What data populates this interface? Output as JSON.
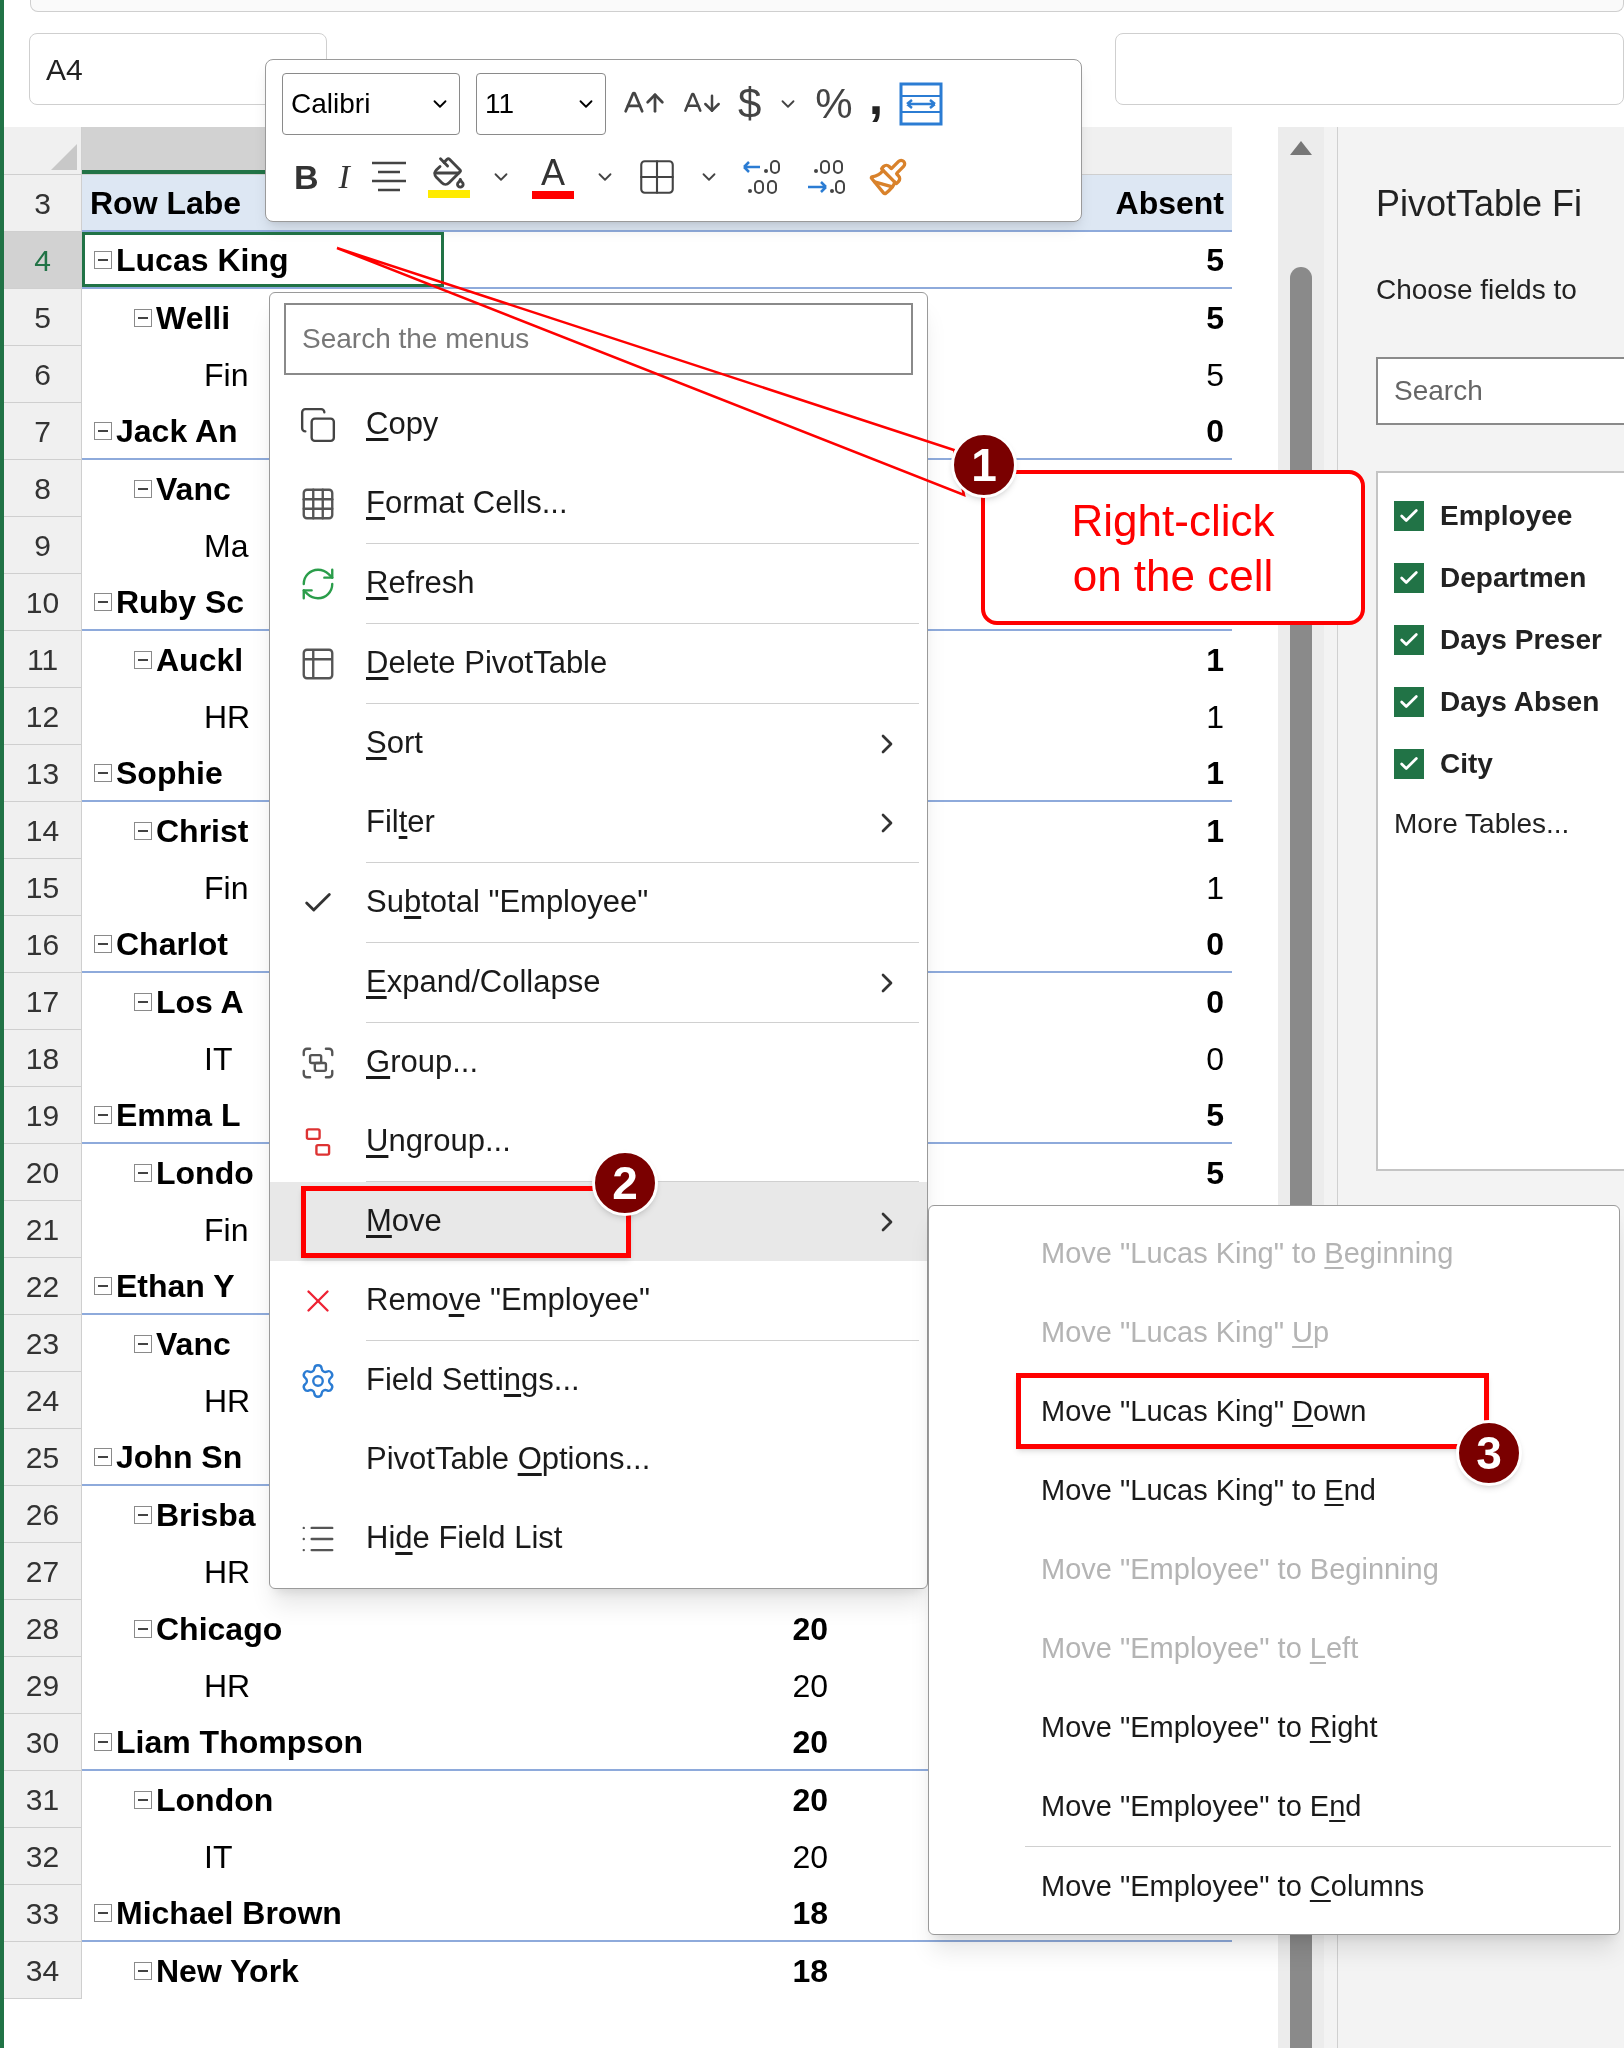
{
  "name_box": "A4",
  "mini_toolbar": {
    "font": "Calibri",
    "size": "11",
    "currency": "$",
    "percent": "%",
    "comma": ",",
    "bold": "B",
    "italic": "I",
    "font_color": "A"
  },
  "sheet": {
    "header_row": {
      "row": "3",
      "label": "Row Labe",
      "absent": "Absent"
    },
    "rows": [
      {
        "row": "4",
        "label": "Lucas King",
        "absent": "5",
        "expanded": true,
        "selected": true,
        "children": [
          {
            "row": "5",
            "label": "Welli",
            "absent": "5",
            "expanded": true,
            "selected": false,
            "children": [
              {
                "row": "6",
                "label": "Fin",
                "absent": "5",
                "selected": false
              }
            ]
          }
        ]
      },
      {
        "row": "7",
        "label": "Jack An",
        "absent": "0",
        "expanded": true,
        "selected": false,
        "children": [
          {
            "row": "8",
            "label": "Vanc",
            "expanded": true,
            "selected": false,
            "children": [
              {
                "row": "9",
                "label": "Ma",
                "selected": false
              }
            ]
          }
        ]
      },
      {
        "row": "10",
        "label": "Ruby Sc",
        "expanded": true,
        "selected": false,
        "children": [
          {
            "row": "11",
            "label": "Auckl",
            "absent": "1",
            "expanded": true,
            "selected": false,
            "children": [
              {
                "row": "12",
                "label": "HR",
                "absent": "1",
                "selected": false
              }
            ]
          }
        ]
      },
      {
        "row": "13",
        "label": "Sophie",
        "absent": "1",
        "expanded": true,
        "selected": false,
        "children": [
          {
            "row": "14",
            "label": "Christ",
            "absent": "1",
            "expanded": true,
            "selected": false,
            "children": [
              {
                "row": "15",
                "label": "Fin",
                "absent": "1",
                "selected": false
              }
            ]
          }
        ]
      },
      {
        "row": "16",
        "label": "Charlot",
        "absent": "0",
        "expanded": true,
        "selected": false,
        "children": [
          {
            "row": "17",
            "label": "Los A",
            "absent": "0",
            "expanded": true,
            "selected": false,
            "children": [
              {
                "row": "18",
                "label": "IT",
                "absent": "0",
                "selected": false
              }
            ]
          }
        ]
      },
      {
        "row": "19",
        "label": "Emma L",
        "absent": "5",
        "expanded": true,
        "selected": false,
        "children": [
          {
            "row": "20",
            "label": "Londo",
            "absent": "5",
            "expanded": true,
            "selected": false,
            "children": [
              {
                "row": "21",
                "label": "Fin",
                "selected": false
              }
            ]
          }
        ]
      },
      {
        "row": "22",
        "label": "Ethan Y",
        "expanded": true,
        "selected": false,
        "children": [
          {
            "row": "23",
            "label": "Vanc",
            "expanded": true,
            "selected": false,
            "children": [
              {
                "row": "24",
                "label": "HR",
                "selected": false
              }
            ]
          }
        ]
      },
      {
        "row": "25",
        "label": "John Sn",
        "expanded": true,
        "selected": false,
        "children": [
          {
            "row": "26",
            "label": "Brisba",
            "expanded": true,
            "selected": false,
            "children": [
              {
                "row": "27",
                "label": "HR",
                "selected": false
              }
            ]
          },
          {
            "row": "28",
            "label": "Chicago",
            "present": "20",
            "expanded": true,
            "selected": false,
            "children": [
              {
                "row": "29",
                "label": "HR",
                "present": "20",
                "selected": false
              }
            ]
          }
        ]
      },
      {
        "row": "30",
        "label": "Liam Thompson",
        "present": "20",
        "expanded": true,
        "selected": false,
        "children": [
          {
            "row": "31",
            "label": "London",
            "present": "20",
            "expanded": true,
            "selected": false,
            "children": [
              {
                "row": "32",
                "label": "IT",
                "present": "20",
                "selected": false
              }
            ]
          }
        ]
      },
      {
        "row": "33",
        "label": "Michael Brown",
        "present": "18",
        "expanded": true,
        "selected": false,
        "children": [
          {
            "row": "34",
            "label": "New York",
            "present": "18",
            "expanded": true,
            "selected": false
          }
        ]
      }
    ]
  },
  "context_menu": {
    "search_placeholder": "Search the menus",
    "items": [
      {
        "kind": "item",
        "key": "C",
        "after": "opy",
        "checked": false,
        "submenu": false,
        "selected": false
      },
      {
        "kind": "item",
        "key": "F",
        "after": "ormat Cells...",
        "checked": false,
        "submenu": false,
        "selected": false
      },
      {
        "kind": "separator"
      },
      {
        "kind": "item",
        "key": "R",
        "after": "efresh",
        "checked": false,
        "submenu": false,
        "selected": false
      },
      {
        "kind": "separator"
      },
      {
        "kind": "item",
        "key": "D",
        "after": "elete PivotTable",
        "checked": false,
        "submenu": false,
        "selected": false
      },
      {
        "kind": "separator"
      },
      {
        "kind": "item",
        "key": "S",
        "after": "ort",
        "checked": false,
        "submenu": true,
        "selected": false
      },
      {
        "kind": "item",
        "before": "Fil",
        "key": "t",
        "after": "er",
        "checked": false,
        "submenu": true,
        "selected": false
      },
      {
        "kind": "separator"
      },
      {
        "kind": "item",
        "before": "Su",
        "key": "b",
        "after": "total \"Employee\"",
        "checked": true,
        "submenu": false,
        "selected": false
      },
      {
        "kind": "separator"
      },
      {
        "kind": "item",
        "key": "E",
        "after": "xpand/Collapse",
        "checked": false,
        "submenu": true,
        "selected": false
      },
      {
        "kind": "separator"
      },
      {
        "kind": "item",
        "key": "G",
        "after": "roup...",
        "checked": false,
        "submenu": false,
        "selected": false
      },
      {
        "kind": "item",
        "key": "U",
        "after": "ngroup...",
        "checked": false,
        "submenu": false,
        "selected": false
      },
      {
        "kind": "separator"
      },
      {
        "kind": "item",
        "key": "M",
        "after": "ove",
        "checked": false,
        "submenu": true,
        "selected": true
      },
      {
        "kind": "item",
        "before": "Remo",
        "key": "v",
        "after": "e \"Employee\"",
        "checked": false,
        "submenu": false,
        "selected": false
      },
      {
        "kind": "separator"
      },
      {
        "kind": "item",
        "before": "Field Setti",
        "key": "n",
        "after": "gs...",
        "checked": false,
        "submenu": false,
        "selected": false
      },
      {
        "kind": "item",
        "before": "PivotTable ",
        "key": "O",
        "after": "ptions...",
        "checked": false,
        "submenu": false,
        "selected": false
      },
      {
        "kind": "item",
        "before": "Hi",
        "key": "d",
        "after": "e Field List",
        "checked": false,
        "submenu": false,
        "selected": false
      }
    ]
  },
  "submenu": {
    "items": [
      {
        "kind": "item",
        "before": "Move \"Lucas King\" to ",
        "key": "B",
        "after": "eginning",
        "disabled": true
      },
      {
        "kind": "item",
        "before": "Move \"Lucas King\" ",
        "key": "U",
        "after": "p",
        "disabled": true
      },
      {
        "kind": "item",
        "before": "Move \"Lucas King\" ",
        "key": "D",
        "after": "own",
        "disabled": false
      },
      {
        "kind": "item",
        "before": "Move \"Lucas King\" to ",
        "key": "E",
        "after": "nd",
        "disabled": false
      },
      {
        "kind": "item",
        "before": "Move \"Employee\" to Be",
        "key": "g",
        "after": "inning",
        "disabled": true
      },
      {
        "kind": "item",
        "before": "Move \"Employee\" to ",
        "key": "L",
        "after": "eft",
        "disabled": true
      },
      {
        "kind": "item",
        "before": "Move \"Employee\" to ",
        "key": "R",
        "after": "ight",
        "disabled": false
      },
      {
        "kind": "item",
        "before": "Move \"Employee\" to E",
        "key": "n",
        "after": "d",
        "disabled": false
      },
      {
        "kind": "separator"
      },
      {
        "kind": "item",
        "before": "Move \"Employee\" to ",
        "key": "C",
        "after": "olumns",
        "disabled": false
      }
    ]
  },
  "annotations": [
    {
      "kind": "callout",
      "number": "1",
      "text": "Right-click on the cell"
    },
    {
      "kind": "box",
      "number": "2"
    },
    {
      "kind": "box",
      "number": "3"
    }
  ],
  "field_pane": {
    "title": "PivotTable Fi",
    "subtitle": "Choose fields to",
    "search_placeholder": "Search",
    "fields": [
      {
        "label": "Employee",
        "checked": true
      },
      {
        "label": "Departmen",
        "checked": true
      },
      {
        "label": "Days Preser",
        "checked": true
      },
      {
        "label": "Days Absen",
        "checked": true
      },
      {
        "label": "City",
        "checked": true
      }
    ],
    "more_link": "More Tables..."
  }
}
